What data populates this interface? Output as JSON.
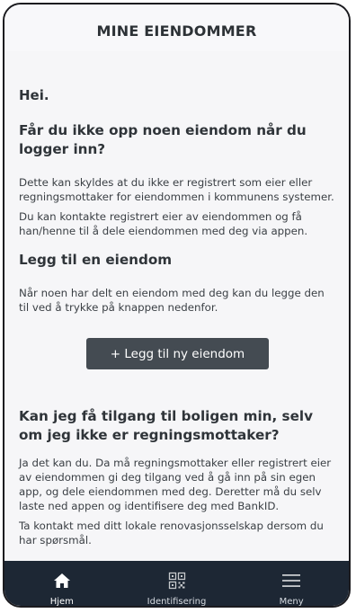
{
  "header": {
    "title": "MINE EIENDOMMER"
  },
  "greeting": "Hei.",
  "no_property": {
    "heading": "Får du ikke opp noen eiendom når du logger inn?",
    "paragraph1": "Dette kan skyldes at du ikke er registrert som eier eller regningsmottaker for eiendommen i kommunens systemer.",
    "paragraph2": "Du kan kontakte registrert eier av eiendommen og få han/henne til å dele eiendommen med deg via appen."
  },
  "add_property": {
    "heading": "Legg til en eiendom",
    "paragraph": "Når noen har delt en eiendom med deg kan du legge den til ved å trykke på knappen nedenfor.",
    "button_label": "+ Legg til ny eiendom"
  },
  "access": {
    "heading": "Kan jeg få tilgang til boligen min, selv om jeg ikke er regningsmottaker?",
    "paragraph1": "Ja det kan du. Da må regningsmottaker eller registrert eier av eiendommen gi deg tilgang ved å gå inn på sin egen app, og dele eiendommen med deg. Deretter må du selv laste ned appen og identifisere deg med BankID.",
    "paragraph2": "Ta kontakt med ditt lokale renovasjonsselskap dersom du har spørsmål."
  },
  "tabbar": {
    "items": [
      {
        "label": "Hjem",
        "icon": "home-icon",
        "active": true
      },
      {
        "label": "Identifisering",
        "icon": "qr-code-icon",
        "active": false
      },
      {
        "label": "Meny",
        "icon": "hamburger-menu-icon",
        "active": false
      }
    ]
  },
  "colors": {
    "tabbar_bg": "#1d2734",
    "button_bg": "#444b52",
    "page_bg": "#f6f6f8",
    "text": "#2f3439"
  }
}
